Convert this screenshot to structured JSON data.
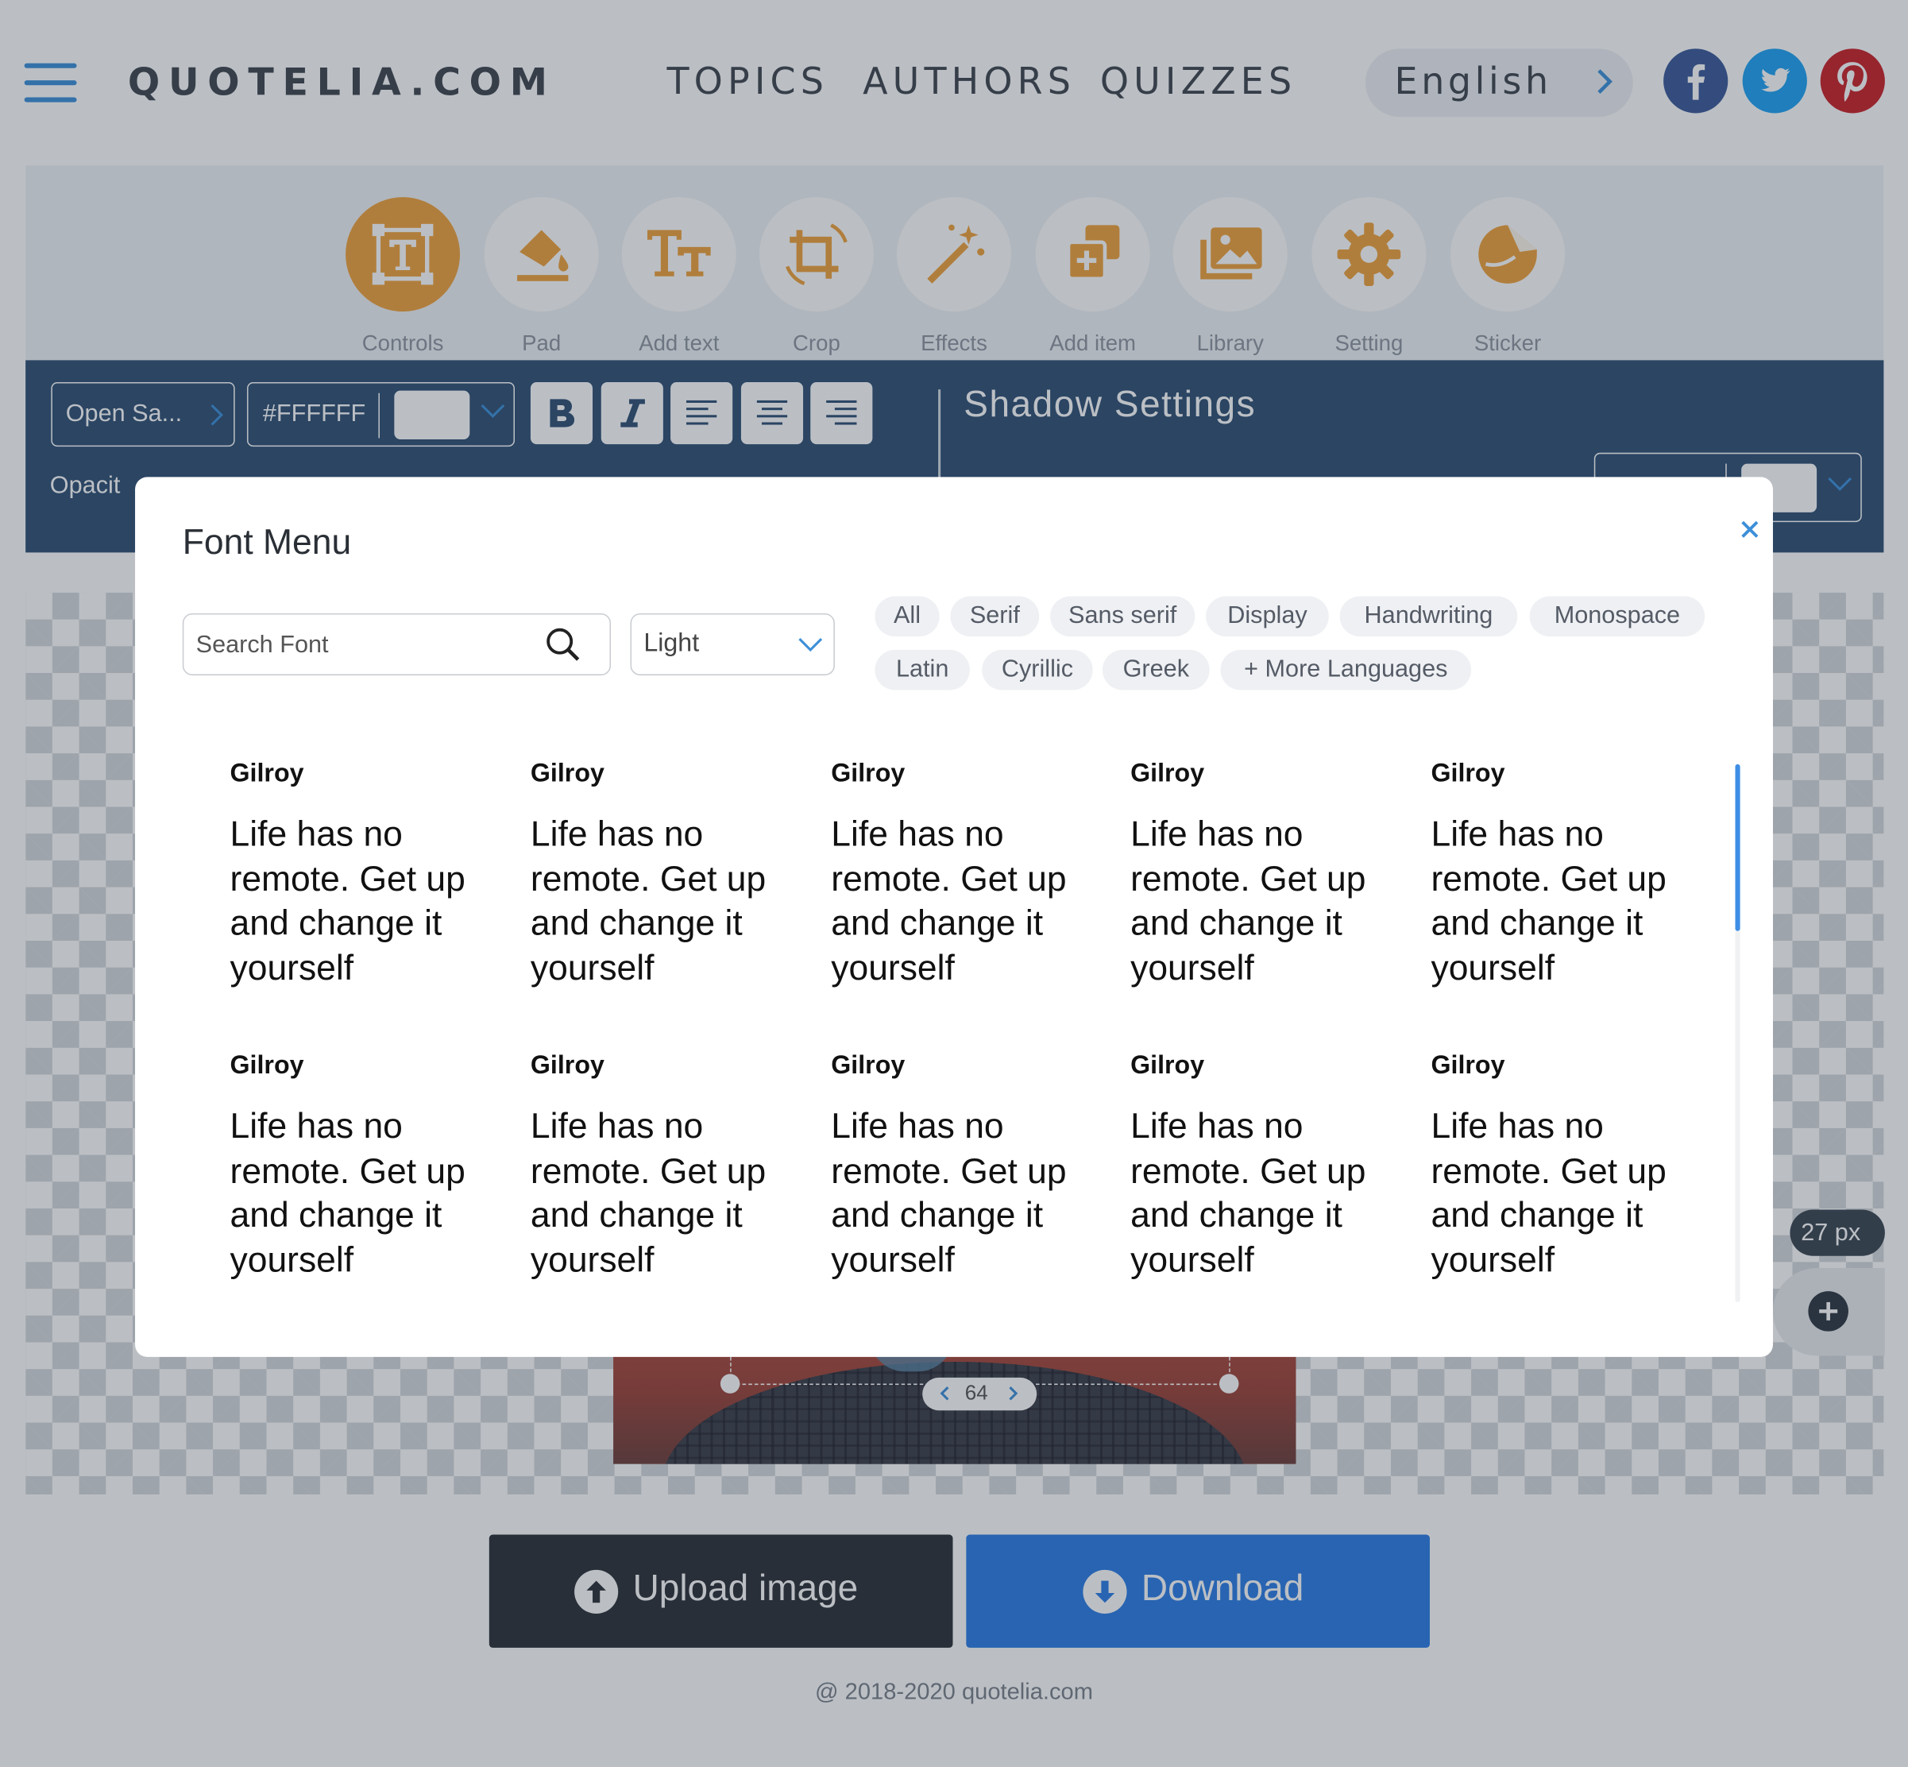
{
  "header": {
    "logo": "QUOTELIA.COM",
    "nav": [
      "TOPICS",
      "AUTHORS",
      "QUIZZES"
    ],
    "language": "English",
    "social": [
      "facebook-icon",
      "twitter-icon",
      "pinterest-icon"
    ]
  },
  "toolbar": {
    "tools": [
      {
        "label": "Controls",
        "icon": "text-box-icon",
        "active": true
      },
      {
        "label": "Pad",
        "icon": "paint-bucket-icon"
      },
      {
        "label": "Add text",
        "icon": "add-text-icon"
      },
      {
        "label": "Crop",
        "icon": "crop-icon"
      },
      {
        "label": "Effects",
        "icon": "magic-wand-icon"
      },
      {
        "label": "Add item",
        "icon": "add-item-icon"
      },
      {
        "label": "Library",
        "icon": "image-library-icon"
      },
      {
        "label": "Setting",
        "icon": "gear-icon"
      },
      {
        "label": "Sticker",
        "icon": "sticker-icon"
      }
    ]
  },
  "settings": {
    "font": "Open Sa...",
    "color_hex": "#FFFFFF",
    "opacity_label": "Opacit",
    "shadow_title": "Shadow Settings",
    "format_buttons": [
      "bold-icon",
      "italic-icon",
      "align-left-icon",
      "align-center-icon",
      "align-right-icon"
    ]
  },
  "canvas": {
    "size_label": "27 px",
    "spacing_value": "64"
  },
  "actions": {
    "upload": "Upload image",
    "download": "Download"
  },
  "footer": "@ 2018-2020 quotelia.com",
  "font_menu": {
    "title": "Font Menu",
    "search_placeholder": "Search Font",
    "weight": "Light",
    "filters": [
      "All",
      "Serif",
      "Sans serif",
      "Display",
      "Handwriting",
      "Monospace",
      "Latin",
      "Cyrillic",
      "Greek",
      "+ More Languages"
    ],
    "fonts": [
      {
        "name": "Gilroy",
        "sample": "Life has no remote. Get up and change it yourself"
      },
      {
        "name": "Gilroy",
        "sample": "Life has no remote. Get up and change it yourself"
      },
      {
        "name": "Gilroy",
        "sample": "Life has no remote. Get up and change it yourself"
      },
      {
        "name": "Gilroy",
        "sample": "Life has no remote. Get up and change it yourself"
      },
      {
        "name": "Gilroy",
        "sample": "Life has no remote. Get up and change it yourself"
      },
      {
        "name": "Gilroy",
        "sample": "Life has no remote. Get up and change it yourself"
      },
      {
        "name": "Gilroy",
        "sample": "Life has no remote. Get up and change it yourself"
      },
      {
        "name": "Gilroy",
        "sample": "Life has no remote. Get up and change it yourself"
      },
      {
        "name": "Gilroy",
        "sample": "Life has no remote. Get up and change it yourself"
      },
      {
        "name": "Gilroy",
        "sample": "Life has no remote. Get up and change it yourself"
      }
    ]
  },
  "colors": {
    "accent": "#3c8fd8",
    "active_tool": "#f0a13a",
    "settings_bar": "#2f4f73",
    "download": "#2a7ce5"
  }
}
